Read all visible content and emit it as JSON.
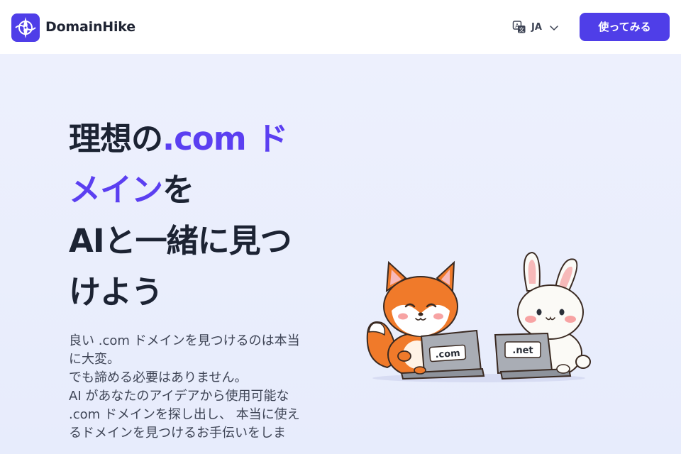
{
  "navbar": {
    "brand": "DomainHike",
    "language": "JA",
    "cta": "使ってみる"
  },
  "hero": {
    "headline": {
      "part1": "理想の",
      "accent1": ".com ド",
      "accent2": "メイン",
      "part2": "を",
      "line3": "AIと一緒に見つ",
      "line4": "けよう"
    },
    "description": [
      "良い .com ドメインを見つけるのは本当",
      "に大変。",
      "でも諦める必要はありません。",
      "AI があなたのアイデアから使用可能な",
      ".com ドメインを探し出し、 本当に使え",
      "るドメインを見つけるお手伝いをしま"
    ],
    "illustration": {
      "fox_laptop": ".com",
      "rabbit_laptop": ".net"
    }
  },
  "colors": {
    "accent": "#4f3ee8",
    "heading": "#1c2333",
    "background": "#eef1fd"
  }
}
